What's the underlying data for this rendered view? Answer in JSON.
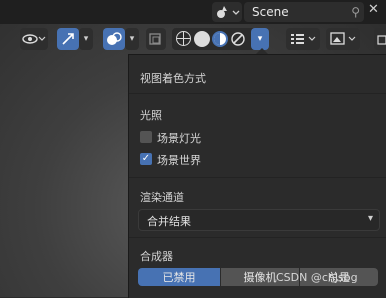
{
  "scene": {
    "name": "Scene"
  },
  "panel": {
    "title": "视图着色方式",
    "lighting": {
      "heading": "光照",
      "scene_lights": {
        "label": "场景灯光",
        "checked": false
      },
      "scene_world": {
        "label": "场景世界",
        "checked": true
      }
    },
    "render_pass": {
      "heading": "渲染通道",
      "value": "合并结果"
    },
    "compositor": {
      "heading": "合成器",
      "options": [
        "已禁用",
        "摄像机",
        "总是"
      ],
      "selected": "已禁用"
    }
  },
  "watermark": "CSDN @chjsbg",
  "colors": {
    "accent": "#4772b3",
    "panel_bg": "#2b2b2b"
  }
}
